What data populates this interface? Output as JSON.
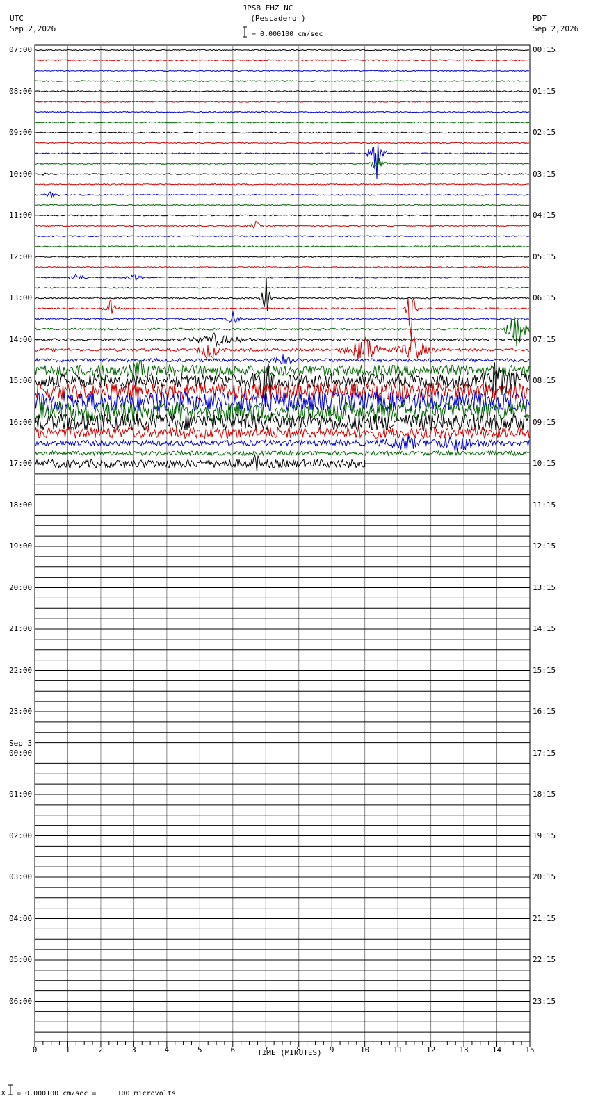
{
  "header": {
    "station": "JPSB EHZ NC",
    "location": "(Pescadero )",
    "left_tz": "UTC",
    "left_date": "Sep 2,2026",
    "right_tz": "PDT",
    "right_date": "Sep 2,2026",
    "scale_text": "= 0.000100 cm/sec"
  },
  "footer": {
    "prefix": "x",
    "scale_text": "= 0.000100 cm/sec =     100 microvolts"
  },
  "chart_data": {
    "type": "line",
    "title": "JPSB EHZ NC (Pescadero )",
    "xlabel": "TIME (MINUTES)",
    "xlim": [
      0,
      15
    ],
    "x_ticks": [
      "0",
      "1",
      "2",
      "3",
      "4",
      "5",
      "6",
      "7",
      "8",
      "9",
      "10",
      "11",
      "12",
      "13",
      "14",
      "15"
    ],
    "rows_per_hour": 4,
    "total_rows": 96,
    "trace_colors": [
      "#000000",
      "#cc0000",
      "#0000cc",
      "#006600"
    ],
    "left_hour_labels": [
      "07:00",
      "08:00",
      "09:00",
      "10:00",
      "11:00",
      "12:00",
      "13:00",
      "14:00",
      "15:00",
      "16:00",
      "17:00",
      "18:00",
      "19:00",
      "20:00",
      "21:00",
      "22:00",
      "23:00",
      "00:00",
      "01:00",
      "02:00",
      "03:00",
      "04:00",
      "05:00",
      "06:00"
    ],
    "date_change": {
      "hour_index": 17,
      "label": "Sep 3"
    },
    "right_hour_labels": [
      "00:15",
      "01:15",
      "02:15",
      "03:15",
      "04:15",
      "05:15",
      "06:15",
      "07:15",
      "08:15",
      "09:15",
      "10:15",
      "11:15",
      "12:15",
      "13:15",
      "14:15",
      "15:15",
      "16:15",
      "17:15",
      "18:15",
      "19:15",
      "20:15",
      "21:15",
      "22:15",
      "23:15"
    ],
    "active_rows": 41,
    "last_row_end_minute": 10,
    "noise_profile": [
      0.8,
      0.8,
      0.8,
      0.8,
      0.8,
      0.8,
      0.8,
      0.8,
      0.8,
      0.8,
      0.8,
      0.8,
      0.8,
      0.8,
      0.8,
      0.8,
      0.8,
      0.8,
      0.8,
      0.8,
      0.8,
      0.8,
      0.8,
      0.8,
      1,
      1,
      1.2,
      1.4,
      1.6,
      2,
      2.5,
      8,
      10,
      12,
      14,
      14,
      12,
      8,
      4,
      3,
      6
    ],
    "events": [
      {
        "row": 10,
        "minute": 10.35,
        "amp": 48,
        "dur": 0.3
      },
      {
        "row": 11,
        "minute": 10.4,
        "amp": 14,
        "dur": 0.3
      },
      {
        "row": 12,
        "minute": 0.3,
        "amp": 6,
        "dur": 0.1
      },
      {
        "row": 14,
        "minute": 0.5,
        "amp": 6,
        "dur": 0.3
      },
      {
        "row": 17,
        "minute": 6.7,
        "amp": 6,
        "dur": 0.3
      },
      {
        "row": 22,
        "minute": 1.3,
        "amp": 10,
        "dur": 0.3
      },
      {
        "row": 22,
        "minute": 3.0,
        "amp": 8,
        "dur": 0.3
      },
      {
        "row": 24,
        "minute": 7.0,
        "amp": 45,
        "dur": 0.2
      },
      {
        "row": 25,
        "minute": 2.3,
        "amp": 14,
        "dur": 0.3
      },
      {
        "row": 25,
        "minute": 11.4,
        "amp": 50,
        "dur": 0.2
      },
      {
        "row": 26,
        "minute": 6.0,
        "amp": 10,
        "dur": 0.3
      },
      {
        "row": 27,
        "minute": 14.6,
        "amp": 30,
        "dur": 0.5
      },
      {
        "row": 28,
        "minute": 5.5,
        "amp": 10,
        "dur": 1.2
      },
      {
        "row": 29,
        "minute": 5.3,
        "amp": 18,
        "dur": 0.5
      },
      {
        "row": 29,
        "minute": 10.0,
        "amp": 25,
        "dur": 0.8
      },
      {
        "row": 29,
        "minute": 11.5,
        "amp": 22,
        "dur": 0.7
      },
      {
        "row": 30,
        "minute": 7.5,
        "amp": 8,
        "dur": 0.5
      },
      {
        "row": 31,
        "minute": 2.1,
        "amp": 12,
        "dur": 0.3
      },
      {
        "row": 31,
        "minute": 3.2,
        "amp": 12,
        "dur": 0.4
      },
      {
        "row": 32,
        "minute": 7.0,
        "amp": 25,
        "dur": 0.5
      },
      {
        "row": 32,
        "minute": 14.0,
        "amp": 20,
        "dur": 1.0
      },
      {
        "row": 38,
        "minute": 11.2,
        "amp": 12,
        "dur": 0.8
      },
      {
        "row": 38,
        "minute": 12.8,
        "amp": 12,
        "dur": 1.2
      },
      {
        "row": 40,
        "minute": 6.7,
        "amp": 35,
        "dur": 0.1
      }
    ]
  }
}
